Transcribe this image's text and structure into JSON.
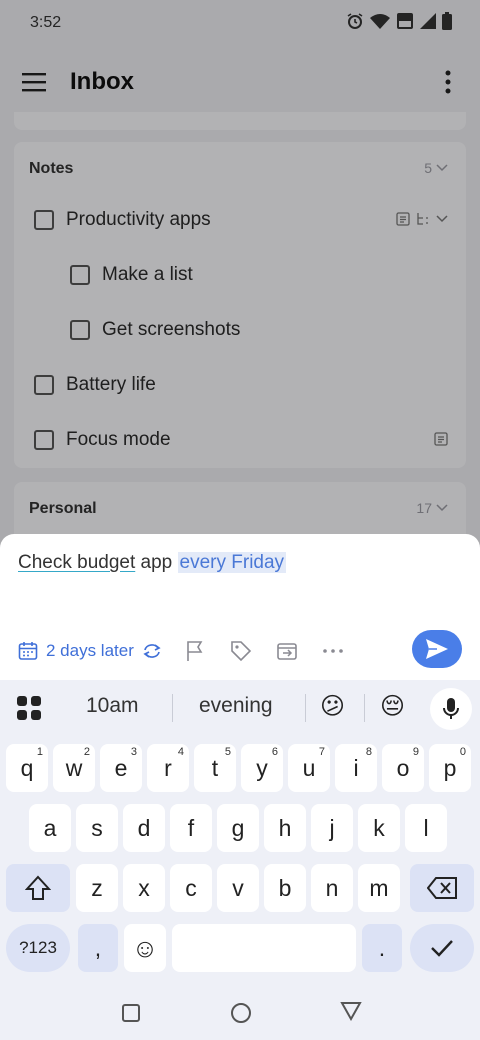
{
  "status": {
    "time": "3:52"
  },
  "header": {
    "title": "Inbox"
  },
  "lists": [
    {
      "title": "Notes",
      "count": "5",
      "tasks": [
        {
          "label": "Productivity apps"
        },
        {
          "label": "Make a list"
        },
        {
          "label": "Get screenshots"
        },
        {
          "label": "Battery life"
        },
        {
          "label": "Focus mode"
        }
      ]
    },
    {
      "title": "Personal",
      "count": "17"
    }
  ],
  "composer": {
    "text_underlined": "Check budget",
    "text_plain": " app ",
    "text_highlight": "every Friday",
    "date_chip": "2 days later"
  },
  "keyboard": {
    "suggestions": [
      "10am",
      "evening"
    ],
    "emoji_suggestions": [
      "😕",
      "😔"
    ],
    "row1": [
      {
        "k": "q",
        "h": "1"
      },
      {
        "k": "w",
        "h": "2"
      },
      {
        "k": "e",
        "h": "3"
      },
      {
        "k": "r",
        "h": "4"
      },
      {
        "k": "t",
        "h": "5"
      },
      {
        "k": "y",
        "h": "6"
      },
      {
        "k": "u",
        "h": "7"
      },
      {
        "k": "i",
        "h": "8"
      },
      {
        "k": "o",
        "h": "9"
      },
      {
        "k": "p",
        "h": "0"
      }
    ],
    "row2": [
      "a",
      "s",
      "d",
      "f",
      "g",
      "h",
      "j",
      "k",
      "l"
    ],
    "row3": [
      "z",
      "x",
      "c",
      "v",
      "b",
      "n",
      "m"
    ],
    "symbols_label": "?123",
    "comma": ",",
    "emoji_key": "☺",
    "period": "."
  },
  "colors": {
    "accent": "#4a7ee8",
    "date_blue": "#3f6fd8"
  }
}
